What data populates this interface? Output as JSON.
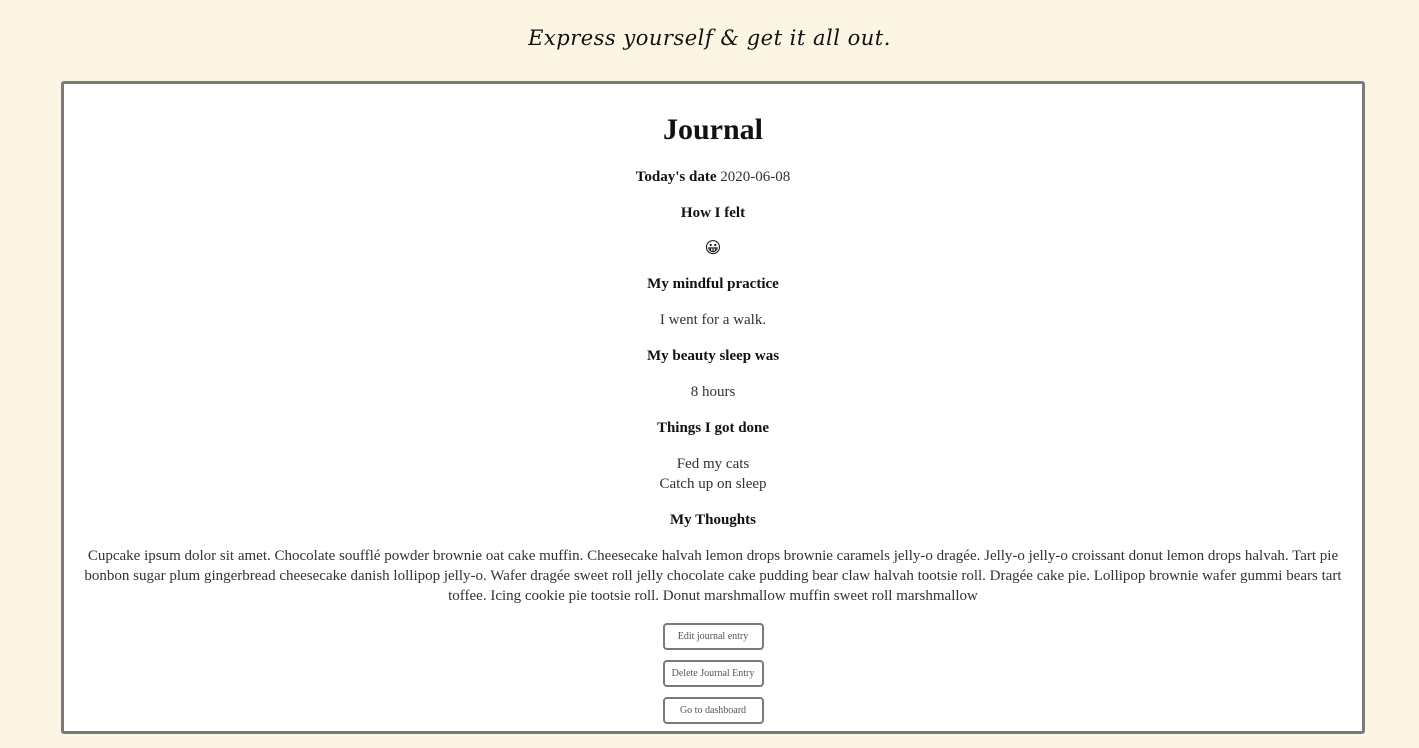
{
  "header": {
    "tagline": "Express yourself & get it all out."
  },
  "journal": {
    "title": "Journal",
    "date_label": "Today's date",
    "date_value": "2020-06-08",
    "felt_heading": "How I felt",
    "mood_icon": "grinning-face-icon",
    "mood_glyph": "😀",
    "practice_heading": "My mindful practice",
    "practice_value": "I went for a walk.",
    "sleep_heading": "My beauty sleep was",
    "sleep_value": "8 hours",
    "done_heading": "Things I got done",
    "done_items": [
      "Fed my cats",
      "Catch up on sleep"
    ],
    "thoughts_heading": "My Thoughts",
    "thoughts_text": "Cupcake ipsum dolor sit amet. Chocolate soufflé powder brownie oat cake muffin. Cheesecake halvah lemon drops brownie caramels jelly-o dragée. Jelly-o jelly-o croissant donut lemon drops halvah. Tart pie bonbon sugar plum gingerbread cheesecake danish lollipop jelly-o. Wafer dragée sweet roll jelly chocolate cake pudding bear claw halvah tootsie roll. Dragée cake pie. Lollipop brownie wafer gummi bears tart toffee. Icing cookie pie tootsie roll. Donut marshmallow muffin sweet roll marshmallow"
  },
  "actions": {
    "edit_label": "Edit journal entry",
    "delete_label": "Delete Journal Entry",
    "dashboard_label": "Go to dashboard"
  }
}
